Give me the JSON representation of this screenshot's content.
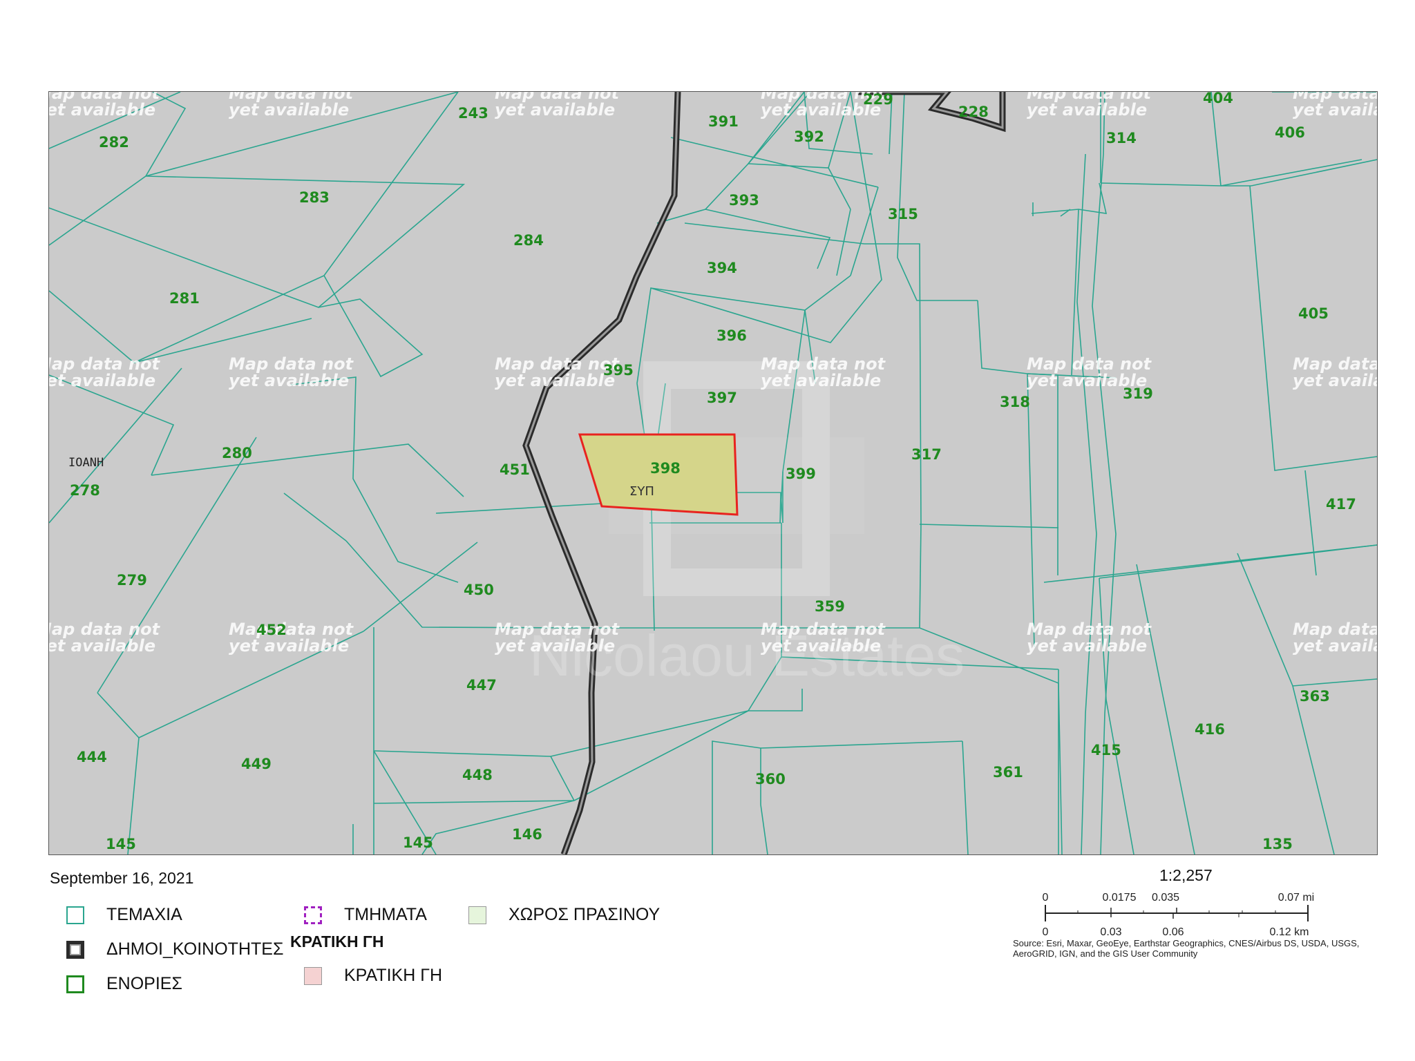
{
  "map": {
    "placeholder_line1": "Map data not",
    "placeholder_line2": "yet available",
    "parcels": [
      {
        "id": "282",
        "text": "282"
      },
      {
        "id": "283",
        "text": "283"
      },
      {
        "id": "243",
        "text": "243"
      },
      {
        "id": "284",
        "text": "284"
      },
      {
        "id": "281",
        "text": "281"
      },
      {
        "id": "280",
        "text": "280"
      },
      {
        "id": "278",
        "text": "278"
      },
      {
        "id": "279",
        "text": "279"
      },
      {
        "id": "452",
        "text": "452"
      },
      {
        "id": "444",
        "text": "444"
      },
      {
        "id": "449",
        "text": "449"
      },
      {
        "id": "145a",
        "text": "145"
      },
      {
        "id": "145b",
        "text": "145"
      },
      {
        "id": "146",
        "text": "146"
      },
      {
        "id": "448",
        "text": "448"
      },
      {
        "id": "447",
        "text": "447"
      },
      {
        "id": "450",
        "text": "450"
      },
      {
        "id": "451",
        "text": "451"
      },
      {
        "id": "395",
        "text": "395"
      },
      {
        "id": "391",
        "text": "391"
      },
      {
        "id": "392",
        "text": "392"
      },
      {
        "id": "229",
        "text": "229"
      },
      {
        "id": "228",
        "text": "228"
      },
      {
        "id": "393",
        "text": "393"
      },
      {
        "id": "394",
        "text": "394"
      },
      {
        "id": "396",
        "text": "396"
      },
      {
        "id": "397",
        "text": "397"
      },
      {
        "id": "398",
        "text": "398"
      },
      {
        "id": "399",
        "text": "399"
      },
      {
        "id": "315",
        "text": "315"
      },
      {
        "id": "317",
        "text": "317"
      },
      {
        "id": "318",
        "text": "318"
      },
      {
        "id": "314",
        "text": "314"
      },
      {
        "id": "404",
        "text": "404"
      },
      {
        "id": "406",
        "text": "406"
      },
      {
        "id": "405",
        "text": "405"
      },
      {
        "id": "319",
        "text": "319"
      },
      {
        "id": "417",
        "text": "417"
      },
      {
        "id": "359",
        "text": "359"
      },
      {
        "id": "360",
        "text": "360"
      },
      {
        "id": "361",
        "text": "361"
      },
      {
        "id": "415",
        "text": "415"
      },
      {
        "id": "416",
        "text": "416"
      },
      {
        "id": "363",
        "text": "363"
      },
      {
        "id": "135",
        "text": "135"
      }
    ],
    "selected_parcel_code": "ΣΥΠ",
    "place_label": "ΙΟΑΝΗ",
    "watermark": "Nicolaou Estates",
    "colors": {
      "background": "#cbcbcb",
      "parcel_line": "#2aa58f",
      "community_border": "#333333",
      "selected_fill": "#d5d58a",
      "selected_outline": "#e8231f",
      "label": "#1f8a1f"
    }
  },
  "date": "September 16, 2021",
  "legend": {
    "items": [
      {
        "label": "ΤΕΜΑΧΙΑ",
        "icon": "parcels-swatch"
      },
      {
        "label": "ΔΗΜΟΙ_ΚΟΙΝΟΤΗΤΕΣ",
        "icon": "communities-swatch"
      },
      {
        "label": "ΕΝΟΡΙΕΣ",
        "icon": "parishes-swatch"
      },
      {
        "label": "ΤΜΗΜΑΤΑ",
        "icon": "sections-swatch"
      },
      {
        "label": "ΚΡΑΤΙΚΗ ΓΗ",
        "icon": "state-land-swatch"
      },
      {
        "label": "ΧΩΡΟΣ ΠΡΑΣΙΝΟΥ",
        "icon": "green-space-swatch"
      }
    ],
    "group_heading": "ΚΡΑΤΙΚΗ ΓΗ"
  },
  "scale": {
    "ratio": "1:2,257",
    "miles_ticks": [
      "0",
      "0.0175",
      "0.035",
      "0.07 mi"
    ],
    "km_ticks": [
      "0",
      "0.03",
      "0.06",
      "0.12 km"
    ]
  },
  "attribution": "Source: Esri, Maxar, GeoEye, Earthstar Geographics, CNES/Airbus DS, USDA, USGS, AeroGRID, IGN, and the GIS User Community"
}
